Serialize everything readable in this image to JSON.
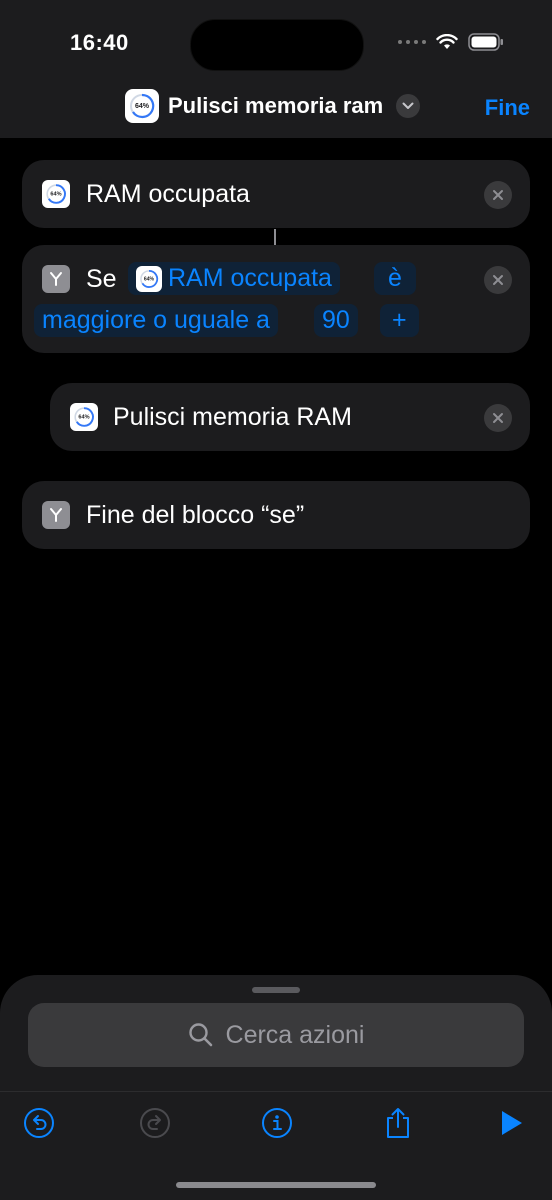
{
  "status": {
    "time": "16:40"
  },
  "header": {
    "title": "Pulisci memoria ram",
    "done_label": "Fine",
    "app_icon_text": "64%"
  },
  "actions": {
    "ram": {
      "label": "RAM occupata"
    },
    "if": {
      "keyword": "Se",
      "variable": "RAM occupata",
      "verb": "è",
      "operator": "maggiore o uguale a",
      "value": "90",
      "add": "+"
    },
    "clean": {
      "label": "Pulisci memoria RAM"
    },
    "endif": {
      "label": "Fine del blocco “se”"
    }
  },
  "search": {
    "placeholder": "Cerca azioni"
  },
  "toolbar": {
    "icons": [
      "undo-icon",
      "redo-icon",
      "info-icon",
      "share-icon",
      "play-icon"
    ],
    "accent": "#0a84ff"
  },
  "colors": {
    "accent": "#0a84ff",
    "card": "#1c1c1e",
    "background": "#000000"
  }
}
